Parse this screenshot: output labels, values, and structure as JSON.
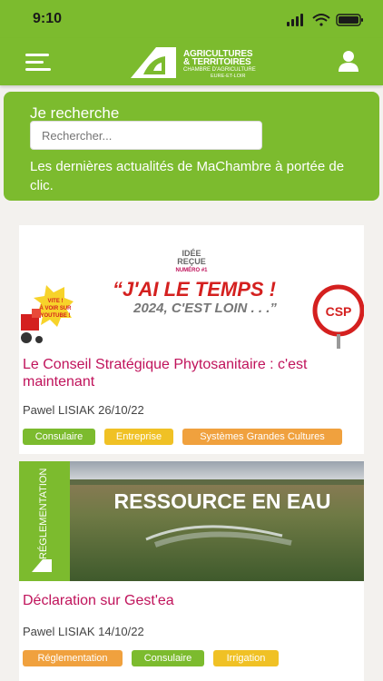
{
  "status_bar": {
    "time": "9:10"
  },
  "header": {
    "logo_line1": "AGRICULTURES",
    "logo_line2": "& TERRITOIRES",
    "logo_line3": "CHAMBRE D'AGRICULTURE",
    "logo_line4": "EURE-ET-LOIR"
  },
  "search": {
    "title": "Je recherche",
    "placeholder": "Rechercher...",
    "description": "Les dernières actualités de MaChambre à portée de clic."
  },
  "articles": [
    {
      "image": {
        "idee": "IDÉE",
        "recue": "REÇUE",
        "numero": "NUMÉRO #1",
        "quote_line1": "“J'AI LE TEMPS !",
        "quote_line2": "2024, C'EST LOIN . . .”",
        "badge_line1": "VITE !",
        "badge_line2": "À VOIR SUR",
        "badge_line3": "YOUTUBE !",
        "sign": "CSP"
      },
      "title": "Le Conseil Stratégique Phytosanitaire : c'est maintenant",
      "meta": "Pawel LISIAK 26/10/22",
      "tags": [
        "Consulaire",
        "Entreprise",
        "Systèmes Grandes Cultures"
      ]
    },
    {
      "image": {
        "side_label": "RÉGLEMENTATION",
        "headline": "RESSOURCE EN EAU"
      },
      "title": "Déclaration sur Gest'ea",
      "meta": "Pawel LISIAK 14/10/22",
      "tags": [
        "Réglementation",
        "Consulaire",
        "Irrigation"
      ]
    }
  ],
  "colors": {
    "brand_green": "#7cbb2e",
    "title_magenta": "#c0135b",
    "tag_green": "#7cbb2e",
    "tag_yellow": "#f0c125",
    "tag_orange": "#f0a13e"
  }
}
